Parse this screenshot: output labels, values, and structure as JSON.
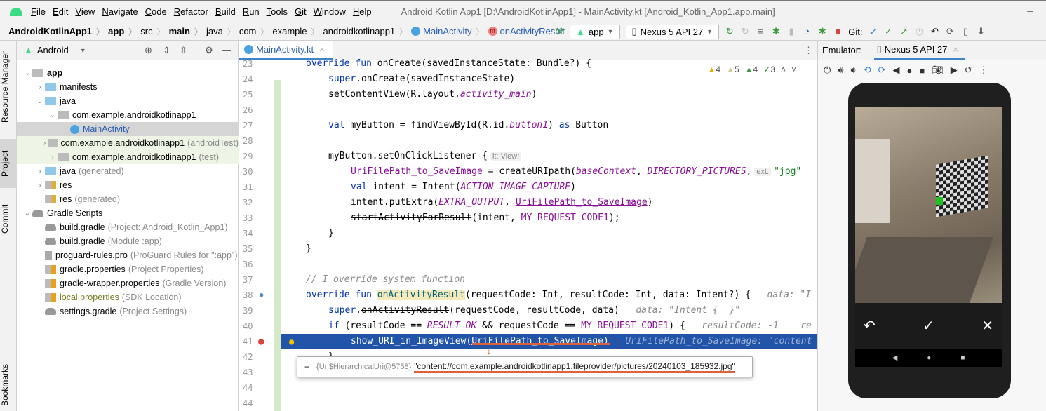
{
  "menu": [
    "File",
    "Edit",
    "View",
    "Navigate",
    "Code",
    "Refactor",
    "Build",
    "Run",
    "Tools",
    "Git",
    "Window",
    "Help"
  ],
  "window_title": "Android Kotlin App1 [D:\\AndroidKotlinApp1] - MainActivity.kt [Android_Kotlin_App1.app.main]",
  "breadcrumb": [
    "AndroidKotlinApp1",
    "app",
    "src",
    "main",
    "java",
    "com",
    "example",
    "androidkotlinapp1",
    "MainActivity",
    "onActivityResult"
  ],
  "toolbar": {
    "run_config": "app",
    "device": "Nexus 5 API 27",
    "git_label": "Git:"
  },
  "project": {
    "view_selector": "Android",
    "tree": [
      {
        "depth": 0,
        "arrow": "v",
        "icon": "pkg",
        "label": "app",
        "bold": true
      },
      {
        "depth": 1,
        "arrow": ">",
        "icon": "folder",
        "label": "manifests"
      },
      {
        "depth": 1,
        "arrow": "v",
        "icon": "folder",
        "label": "java"
      },
      {
        "depth": 2,
        "arrow": "v",
        "icon": "pkg",
        "label": "com.example.androidkotlinapp1"
      },
      {
        "depth": 3,
        "arrow": "",
        "icon": "cls",
        "label": "MainActivity",
        "selected": true
      },
      {
        "depth": 2,
        "arrow": ">",
        "icon": "pkg",
        "label": "com.example.androidkotlinapp1",
        "dim": "(androidTest)",
        "tint": true
      },
      {
        "depth": 2,
        "arrow": ">",
        "icon": "pkg",
        "label": "com.example.androidkotlinapp1",
        "dim": "(test)",
        "tint": true
      },
      {
        "depth": 1,
        "arrow": ">",
        "icon": "folder",
        "label": "java",
        "dim": "(generated)"
      },
      {
        "depth": 1,
        "arrow": ">",
        "icon": "res",
        "label": "res"
      },
      {
        "depth": 1,
        "arrow": "",
        "icon": "res",
        "label": "res",
        "dim": "(generated)"
      },
      {
        "depth": 0,
        "arrow": "v",
        "icon": "gradle",
        "label": "Gradle Scripts"
      },
      {
        "depth": 1,
        "arrow": "",
        "icon": "gradle",
        "label": "build.gradle",
        "dim": "(Project: Android_Kotlin_App1)"
      },
      {
        "depth": 1,
        "arrow": "",
        "icon": "gradle",
        "label": "build.gradle",
        "dim": "(Module :app)"
      },
      {
        "depth": 1,
        "arrow": "",
        "icon": "file",
        "label": "proguard-rules.pro",
        "dim": "(ProGuard Rules for \":app\")"
      },
      {
        "depth": 1,
        "arrow": "",
        "icon": "props",
        "label": "gradle.properties",
        "dim": "(Project Properties)"
      },
      {
        "depth": 1,
        "arrow": "",
        "icon": "props",
        "label": "gradle-wrapper.properties",
        "dim": "(Gradle Version)"
      },
      {
        "depth": 1,
        "arrow": "",
        "icon": "props",
        "label": "local.properties",
        "dim": "(SDK Location)",
        "olive": true
      },
      {
        "depth": 1,
        "arrow": "",
        "icon": "gradle",
        "label": "settings.gradle",
        "dim": "(Project Settings)"
      }
    ]
  },
  "side_tabs": [
    "Resource Manager",
    "Project",
    "Commit",
    "Bookmarks"
  ],
  "editor": {
    "tab": "MainActivity.kt",
    "inspections": [
      "4",
      "5",
      "4",
      "3"
    ],
    "lines": [
      {
        "n": "23",
        "indent": 0,
        "tokens": [
          [
            "override fun ",
            "kw"
          ],
          [
            "onCreate(savedInstanceState: Bundle?) {",
            ""
          ]
        ]
      },
      {
        "n": "24",
        "indent": 1,
        "tokens": [
          [
            "super",
            "kw"
          ],
          [
            ".onCreate(savedInstanceState)",
            ""
          ]
        ]
      },
      {
        "n": "25",
        "indent": 1,
        "tokens": [
          [
            "setContentView(R.layout.",
            ""
          ],
          [
            "activity_main",
            "const"
          ],
          [
            ")",
            ""
          ]
        ]
      },
      {
        "n": "26",
        "indent": 0,
        "tokens": []
      },
      {
        "n": "27",
        "indent": 1,
        "tokens": [
          [
            "val ",
            "kw"
          ],
          [
            "myButton = findViewById(R.id.",
            ""
          ],
          [
            "button1",
            "const"
          ],
          [
            ") ",
            ""
          ],
          [
            "as ",
            "kw"
          ],
          [
            "Button",
            ""
          ]
        ]
      },
      {
        "n": "28",
        "indent": 0,
        "tokens": []
      },
      {
        "n": "29",
        "indent": 1,
        "tokens": [
          [
            "myButton.setOnClickListener {",
            ""
          ],
          [
            "it: View!",
            "inlay"
          ]
        ]
      },
      {
        "n": "30",
        "indent": 2,
        "tokens": [
          [
            "UriFilePath_to_SaveImage",
            "prop"
          ],
          [
            " = createURIpath(",
            ""
          ],
          [
            "baseContext",
            "const"
          ],
          [
            ", ",
            ""
          ],
          [
            "DIRECTORY_PICTURES",
            "const ul"
          ],
          [
            ",",
            ""
          ],
          [
            "ext:",
            "inlay"
          ],
          [
            "\"jpg\"",
            "str"
          ]
        ]
      },
      {
        "n": "31",
        "indent": 2,
        "tokens": [
          [
            "val ",
            "kw"
          ],
          [
            "intent = Intent(",
            ""
          ],
          [
            "ACTION_IMAGE_CAPTURE",
            "const"
          ],
          [
            ")",
            ""
          ]
        ]
      },
      {
        "n": "32",
        "indent": 2,
        "tokens": [
          [
            "intent.putExtra(",
            ""
          ],
          [
            "EXTRA_OUTPUT",
            "const"
          ],
          [
            ", ",
            ""
          ],
          [
            "UriFilePath_to_SaveImage",
            "prop"
          ],
          [
            ")",
            ""
          ]
        ]
      },
      {
        "n": "33",
        "indent": 2,
        "tokens": [
          [
            "startActivityForResult",
            "strike"
          ],
          [
            "(intent, ",
            ""
          ],
          [
            "MY_REQUEST_CODE1",
            "prop-plain"
          ],
          [
            ");",
            ""
          ]
        ]
      },
      {
        "n": "34",
        "indent": 1,
        "tokens": [
          [
            "}",
            ""
          ]
        ]
      },
      {
        "n": "35",
        "indent": 0,
        "tokens": [
          [
            "}",
            ""
          ]
        ]
      },
      {
        "n": "36",
        "indent": 0,
        "tokens": []
      },
      {
        "n": "37",
        "indent": 0,
        "tokens": [
          [
            "// I override system function",
            "cm"
          ]
        ]
      },
      {
        "n": "38",
        "indent": 0,
        "tokens": [
          [
            "override fun ",
            "kw"
          ],
          [
            "onActivityResult",
            "fn"
          ],
          [
            "(requestCode: Int, resultCode: Int, data: Intent?) {",
            ""
          ],
          [
            "   data: \"I",
            "hint"
          ]
        ]
      },
      {
        "n": "39",
        "indent": 1,
        "tokens": [
          [
            "super",
            "kw"
          ],
          [
            ".",
            ""
          ],
          [
            "onActivityResult",
            "strike"
          ],
          [
            "(requestCode, resultCode, data)",
            ""
          ],
          [
            "   data: \"Intent {  }\"",
            "hint"
          ]
        ]
      },
      {
        "n": "40",
        "indent": 1,
        "tokens": [
          [
            "if ",
            "kw"
          ],
          [
            "(resultCode == ",
            ""
          ],
          [
            "RESULT_OK",
            "const"
          ],
          [
            " && requestCode == ",
            ""
          ],
          [
            "MY_REQUEST_CODE1",
            "prop-plain"
          ],
          [
            ") {",
            ""
          ],
          [
            "   resultCode: -1    re",
            "hint"
          ]
        ]
      },
      {
        "n": "41",
        "indent": 2,
        "hl": true,
        "tokens": [
          [
            "show_URI_in_ImageView(",
            ""
          ],
          [
            "UriFilePath_to_SaveImage",
            "ul"
          ],
          [
            ")",
            ""
          ],
          [
            "   UriFilePath_to_SaveImage: \"content",
            "hint"
          ]
        ]
      },
      {
        "n": "42",
        "indent": 1,
        "tokens": [
          [
            "}",
            ""
          ]
        ]
      },
      {
        "n": "43",
        "indent": 0,
        "tokens": []
      },
      {
        "n": "44",
        "indent": 0,
        "tokens": []
      },
      {
        "n": "44",
        "indent": 0,
        "tokens": []
      }
    ],
    "tooltip": {
      "expand": "+",
      "type": "{Uri$HierarchicalUri@5758}",
      "value": "\"content://com.example.androidkotlinapp1.fileprovider/pictures/20240103_185932.jpg\""
    }
  },
  "emulator": {
    "label": "Emulator:",
    "tab": "Nexus 5 API 27",
    "camera_controls": [
      "retake",
      "confirm",
      "cancel"
    ]
  },
  "colors": {
    "accent": "#4083c9",
    "highlight_line": "#2154a8",
    "annotation": "#e0603a"
  }
}
